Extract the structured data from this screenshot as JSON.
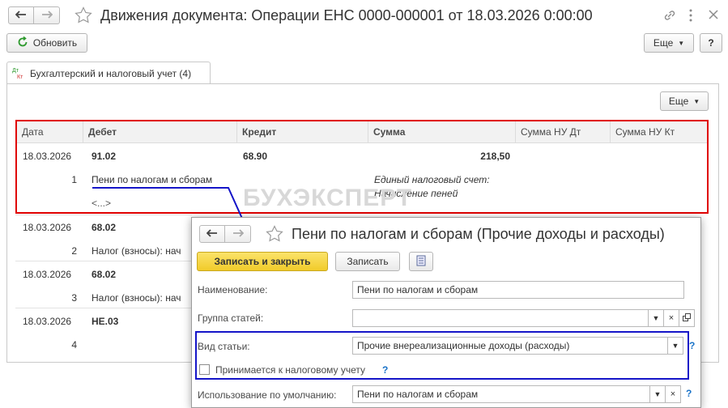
{
  "window": {
    "title": "Движения документа: Операции ЕНС 0000-000001 от 18.03.2026 0:00:00"
  },
  "toolbar": {
    "refresh_label": "Обновить",
    "more_label": "Еще",
    "help_label": "?"
  },
  "tab": {
    "label": "Бухгалтерский и налоговый учет (4)",
    "icon_text_top": "Дт",
    "icon_text_bottom": "Кт"
  },
  "panel": {
    "more_label": "Еще"
  },
  "table": {
    "columns": [
      "Дата",
      "Дебет",
      "Кредит",
      "Сумма",
      "Сумма НУ Дт",
      "Сумма НУ Кт"
    ],
    "rows": [
      {
        "date": "18.03.2026",
        "debit": "91.02",
        "credit": "68.90",
        "amount": "218,50",
        "num": "1",
        "debit_sub": "Пени по налогам и сборам",
        "debit_sub2": "<...>",
        "note1": "Единый налоговый счет:",
        "note2": "Начисление пеней"
      },
      {
        "date": "18.03.2026",
        "debit": "68.02",
        "num": "2",
        "debit_sub": "Налог (взносы): нач"
      },
      {
        "date": "18.03.2026",
        "debit": "68.02",
        "num": "3",
        "debit_sub": "Налог (взносы): нач"
      },
      {
        "date": "18.03.2026",
        "debit": "НЕ.03",
        "num": "4"
      }
    ]
  },
  "watermark": "БУХЭКСПЕРТ",
  "dialog": {
    "title": "Пени по налогам и сборам (Прочие доходы и расходы)",
    "save_close_label": "Записать и закрыть",
    "save_label": "Записать",
    "fields": {
      "name_label": "Наименование:",
      "name_value": "Пени по налогам и сборам",
      "group_label": "Группа статей:",
      "group_value": "",
      "kind_label": "Вид статьи:",
      "kind_value": "Прочие внереализационные доходы (расходы)",
      "tax_checkbox_label": "Принимается к налоговому учету",
      "default_label": "Использование по умолчанию:",
      "default_value": "Пени по налогам и сборам"
    },
    "help_mark": "?"
  },
  "colors": {
    "accent_yellow": "#f5d33a",
    "highlight_red": "#e00000",
    "highlight_blue": "#1515c8",
    "help_blue": "#1a73c8"
  }
}
